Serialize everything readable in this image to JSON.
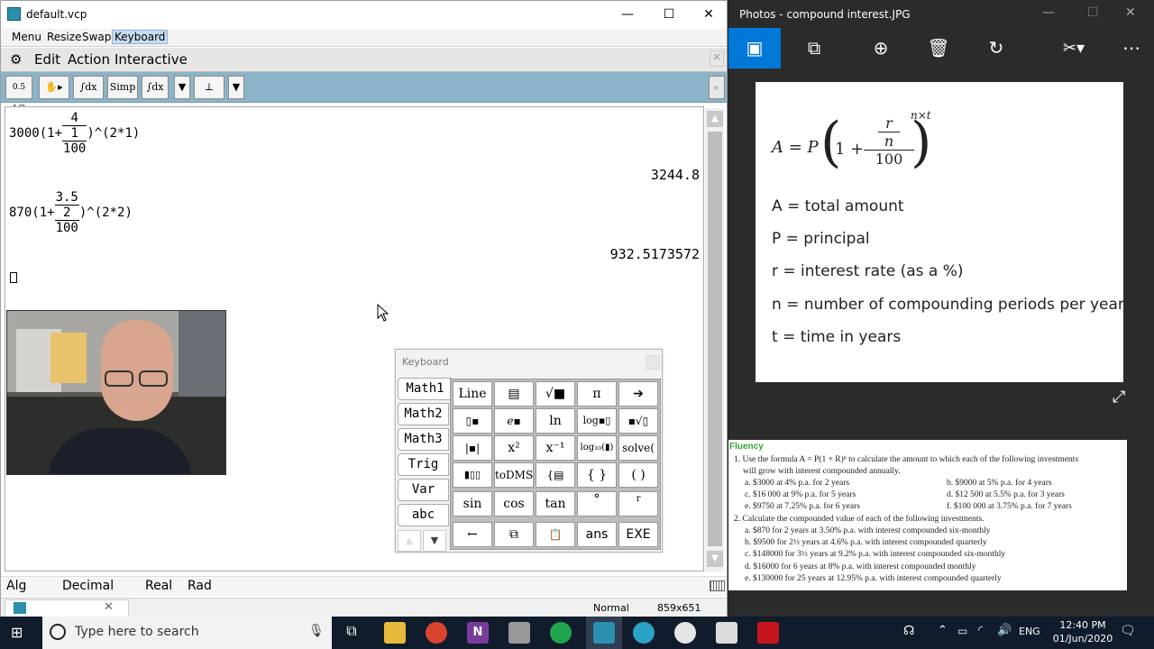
{
  "cas": {
    "title": "default.vcp",
    "controls": {
      "min": "—",
      "max": "☐",
      "close": "✕"
    },
    "menu": [
      "Menu",
      "Resize",
      "Swap",
      "Keyboard"
    ],
    "cmdbar": {
      "gear": "⚙",
      "items": [
        "Edit",
        "Action",
        "Interactive"
      ],
      "close": "✕"
    },
    "toolbar": {
      "b1": "0.5 1/2",
      "b3": "∫dx",
      "simp": "Simp",
      "b5": "∫dx",
      "arrow": "▼"
    },
    "lines": [
      {
        "pre": "3000(1+",
        "num": "4",
        "mid": "1",
        "den": "100",
        "post": ")^(2*1)",
        "result": "3244.8"
      },
      {
        "pre": "870(1+",
        "num": "3.5",
        "mid": "2",
        "den": "100",
        "post": ")^(2*2)",
        "result": "932.5173572"
      }
    ],
    "status": {
      "mode": "Alg",
      "format": "Decimal",
      "domain": "Real",
      "angle": "Rad"
    },
    "bottom": {
      "normal": "Normal",
      "size": "859x651"
    }
  },
  "keyboard": {
    "title": "Keyboard",
    "tabs": [
      "Math1",
      "Math2",
      "Math3",
      "Trig",
      "Var",
      "abc"
    ],
    "keys": [
      [
        "Line",
        "▤",
        "√■",
        "π",
        "➔"
      ],
      [
        "▯▪",
        "e▪",
        "ln",
        "log▪▯",
        "▪√▯"
      ],
      [
        "|▪|",
        "x²",
        "x⁻¹",
        "log₁₀(▮)",
        "solve("
      ],
      [
        "▮▯▯",
        "toDMS",
        "{▤",
        "{ }",
        "( )"
      ],
      [
        "sin",
        "cos",
        "tan",
        "°",
        "r"
      ],
      [
        "←",
        "⧉",
        "📋",
        "ans",
        "EXE"
      ]
    ],
    "nav": [
      "▲",
      "▼"
    ]
  },
  "photos": {
    "title": "Photos - compound interest.JPG",
    "formula": {
      "lhs": "A = P",
      "exp": "n×t",
      "one": "1 +",
      "r": "r",
      "n": "n",
      "hundred": "100"
    },
    "definitions": [
      "A = total amount",
      "P = principal",
      "r = interest rate (as a %)",
      "n = number of compounding periods per year",
      "t = time in years"
    ],
    "fluency": {
      "heading": "Fluency",
      "q1": "1. Use the formula A = P(1 + R)ⁿ to calculate the amount to which each of the following investments",
      "q1b": "will grow with interest compounded annually.",
      "q1_items": [
        "a. $3000 at 4% p.a. for 2 years",
        "b. $9000 at 5% p.a. for 4 years",
        "c. $16 000 at 9% p.a. for 5 years",
        "d. $12 500 at 5.5% p.a. for 3 years",
        "e. $9750 at 7.25% p.a. for 6 years",
        "f. $100 000 at 3.75% p.a. for 7 years"
      ],
      "q2": "2. Calculate the compounded value of each of the following investments.",
      "q2_items": [
        "a. $870 for 2 years at 3.50% p.a. with interest compounded six-monthly",
        "b. $9500 for 2½ years at 4.6% p.a. with interest compounded quarterly",
        "c. $148000 for 3½ years at 9.2% p.a. with interest compounded six-monthly",
        "d. $16000 for 6 years at 8% p.a. with interest compounded monthly",
        "e. $130000 for 25 years at 12.95% p.a. with interest compounded quarterly"
      ]
    }
  },
  "taskbar": {
    "search_placeholder": "Type here to search",
    "lang": "ENG",
    "time": "12:40 PM",
    "date": "01/Jun/2020"
  },
  "colors": {
    "accent": "#0078d7",
    "toolbar": "#8cb4c8",
    "taskbar": "#101c2b"
  }
}
